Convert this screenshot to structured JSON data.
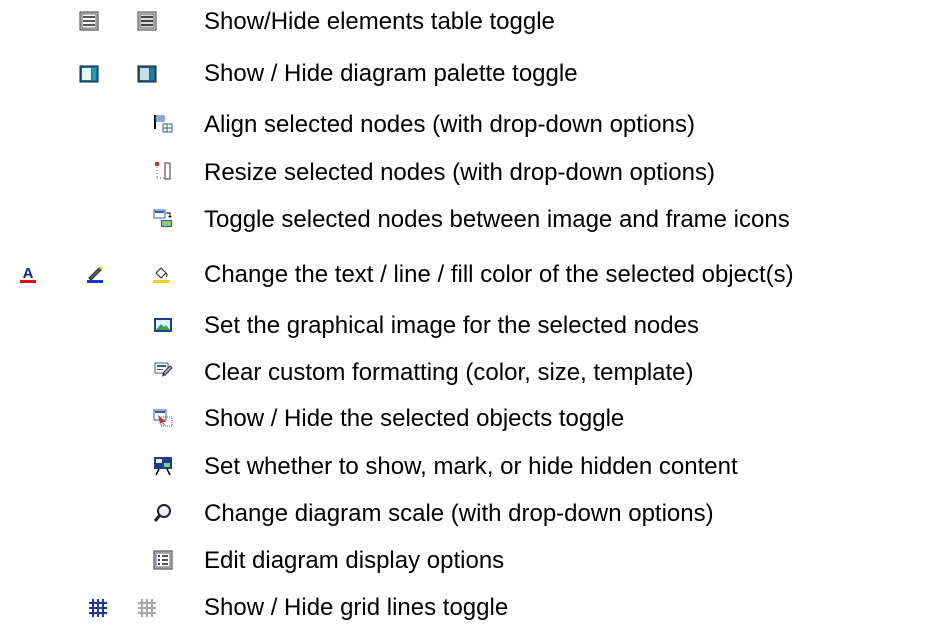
{
  "legend": [
    {
      "label": "Show/Hide elements table toggle",
      "icons": [
        "elements-table-icon",
        "elements-table-pressed-icon"
      ]
    },
    {
      "label": "Show / Hide diagram palette toggle",
      "icons": [
        "diagram-palette-icon",
        "diagram-palette-pressed-icon"
      ]
    },
    {
      "label": "Align selected nodes (with drop-down options)",
      "icons": [
        "align-nodes-icon"
      ]
    },
    {
      "label": "Resize selected nodes (with drop-down options)",
      "icons": [
        "resize-nodes-icon"
      ]
    },
    {
      "label": "Toggle selected nodes between image and frame icons",
      "icons": [
        "toggle-image-frame-icon"
      ]
    },
    {
      "label": "Change the text / line / fill color of the selected object(s)",
      "icons": [
        "text-color-icon",
        "line-color-icon",
        "fill-color-icon"
      ]
    },
    {
      "label": "Set the graphical image for the selected nodes",
      "icons": [
        "set-image-icon"
      ]
    },
    {
      "label": "Clear custom formatting (color, size, template)",
      "icons": [
        "clear-formatting-icon"
      ]
    },
    {
      "label": "Show / Hide the selected objects toggle",
      "icons": [
        "hide-selected-icon"
      ]
    },
    {
      "label": "Set whether to show, mark, or hide hidden content",
      "icons": [
        "hidden-content-icon"
      ]
    },
    {
      "label": "Change diagram scale (with drop-down options)",
      "icons": [
        "zoom-icon"
      ]
    },
    {
      "label": "Edit diagram display options",
      "icons": [
        "display-options-icon"
      ]
    },
    {
      "label": "Show / Hide grid lines toggle",
      "icons": [
        "grid-lines-icon",
        "grid-lines-disabled-icon"
      ]
    }
  ]
}
